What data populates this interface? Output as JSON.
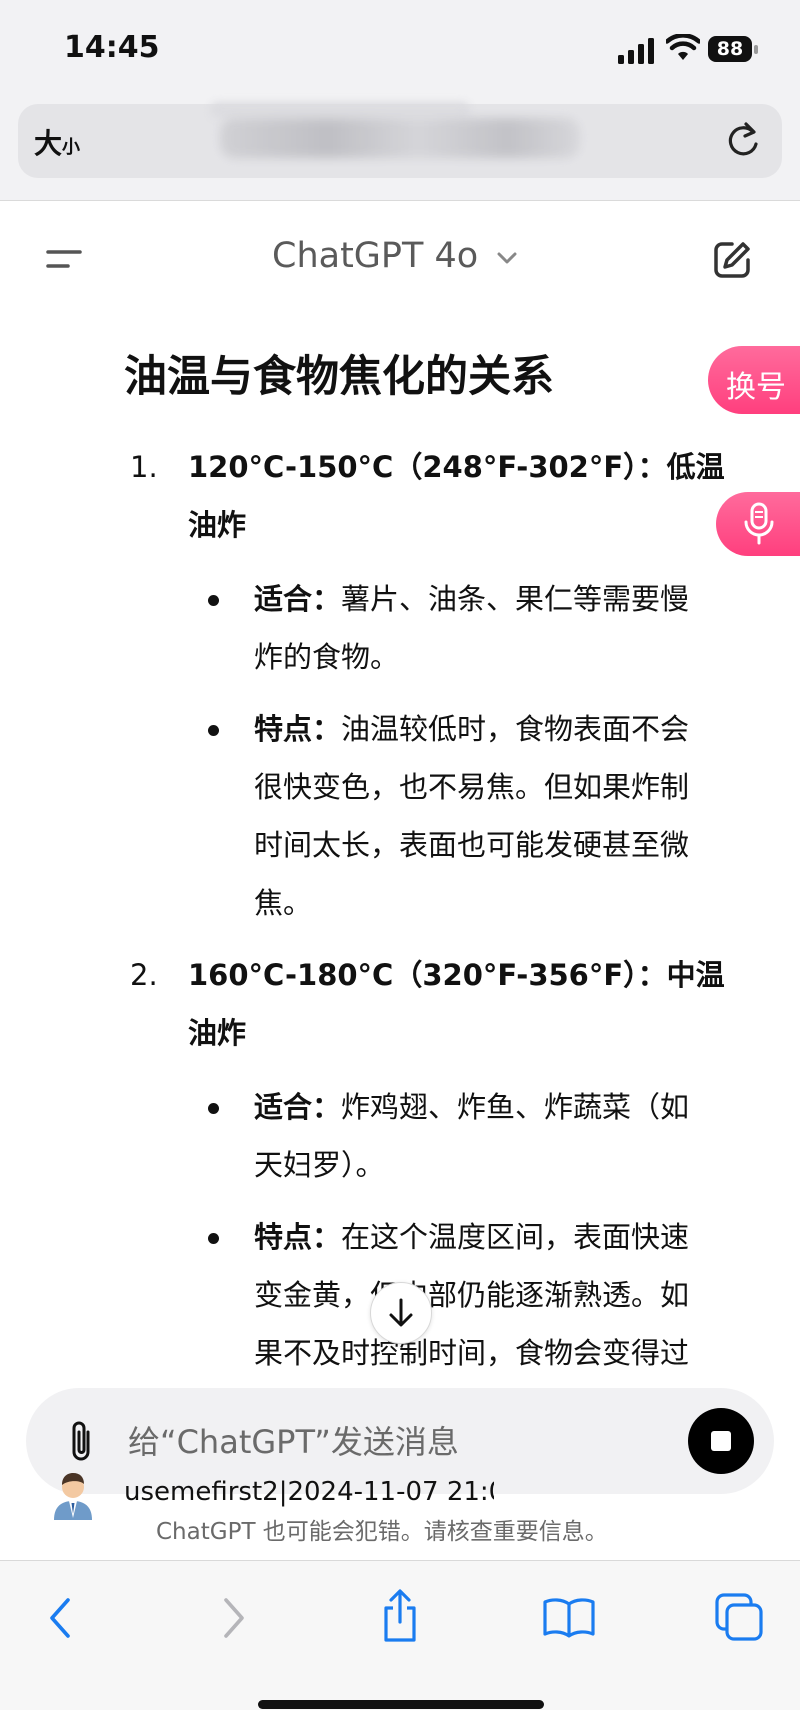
{
  "status_bar": {
    "time": "14:45",
    "battery": "88"
  },
  "browser": {
    "text_size_label": "大",
    "text_size_small": "小"
  },
  "chat_header": {
    "model": "ChatGPT 4o"
  },
  "article": {
    "heading": "油温与食物焦化的关系",
    "items": [
      {
        "number": "1.",
        "title_line1": "120°C-150°C（248°F-302°F）：低温",
        "title_line2": "油炸",
        "bullets": [
          {
            "label": "适合：",
            "line1_rest": "薯片、油条、果仁等需要慢",
            "lines": [
              "炸的食物。"
            ]
          },
          {
            "label": "特点：",
            "line1_rest": "油温较低时，食物表面不会",
            "lines": [
              "很快变色，也不易焦。但如果炸制",
              "时间太长，表面也可能发硬甚至微",
              "焦。"
            ]
          }
        ]
      },
      {
        "number": "2.",
        "title_line1": "160°C-180°C（320°F-356°F）：中温",
        "title_line2": "油炸",
        "bullets": [
          {
            "label": "适合：",
            "line1_rest": "炸鸡翅、炸鱼、炸蔬菜（如",
            "lines": [
              "天妇罗）。"
            ]
          },
          {
            "label": "特点：",
            "line1_rest": "在这个温度区间，表面快速",
            "lines": [
              "变金黄，但内部仍能逐渐熟透。如",
              "果不及时控制时间，食物会变得过"
            ]
          }
        ]
      }
    ]
  },
  "floating": {
    "account_switch": "换号"
  },
  "composer": {
    "placeholder": "给“ChatGPT”发送消息"
  },
  "watermark": "usemefirst2|2024-11-07 21:0",
  "disclaimer": "ChatGPT 也可能会犯错。请核查重要信息。",
  "icons": {
    "menu": "menu-icon",
    "new_chat": "edit-icon",
    "attach": "paperclip-icon",
    "stop": "stop-icon",
    "scroll": "arrow-down-icon",
    "mic": "microphone-icon",
    "reload": "reload-icon",
    "back": "chevron-left-icon",
    "forward": "chevron-right-icon",
    "share": "share-icon",
    "bookmarks": "book-icon",
    "tabs": "tabs-icon"
  },
  "colors": {
    "accent_pink": "#ff4f88",
    "safari_blue": "#1a7cf0"
  }
}
